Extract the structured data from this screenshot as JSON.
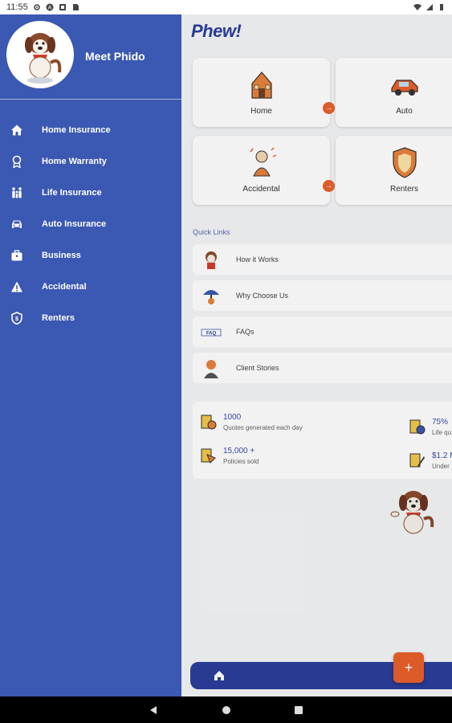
{
  "status": {
    "time": "11:55"
  },
  "app": {
    "logo": "Phew!"
  },
  "drawer": {
    "title": "Meet Phido",
    "items": [
      {
        "label": "Home Insurance",
        "icon": "house-icon"
      },
      {
        "label": "Home Warranty",
        "icon": "award-ribbon-icon"
      },
      {
        "label": "Life Insurance",
        "icon": "family-icon"
      },
      {
        "label": "Auto Insurance",
        "icon": "car-icon"
      },
      {
        "label": "Business",
        "icon": "briefcase-icon"
      },
      {
        "label": "Accidental",
        "icon": "warning-triangle-icon"
      },
      {
        "label": "Renters",
        "icon": "shield-icon"
      }
    ]
  },
  "cards": [
    {
      "label": "Home"
    },
    {
      "label": "Auto"
    },
    {
      "label": "Accidental"
    },
    {
      "label": "Renters"
    }
  ],
  "quick_links": {
    "title": "Quick Links",
    "items": [
      {
        "label": "How it Works"
      },
      {
        "label": "Why Choose Us"
      },
      {
        "label": "FAQs"
      },
      {
        "label": "Client Stories"
      }
    ]
  },
  "stats": [
    {
      "value": "1000",
      "label": "Quotes generated each day"
    },
    {
      "value": "15,000 +",
      "label": "Policies sold"
    },
    {
      "value": "75%",
      "label": "Life qu"
    },
    {
      "value": "$1.2 M",
      "label": "Under"
    }
  ],
  "colors": {
    "drawer": "#3b58b2",
    "brand": "#2c3e9b",
    "accent": "#e8602c"
  }
}
